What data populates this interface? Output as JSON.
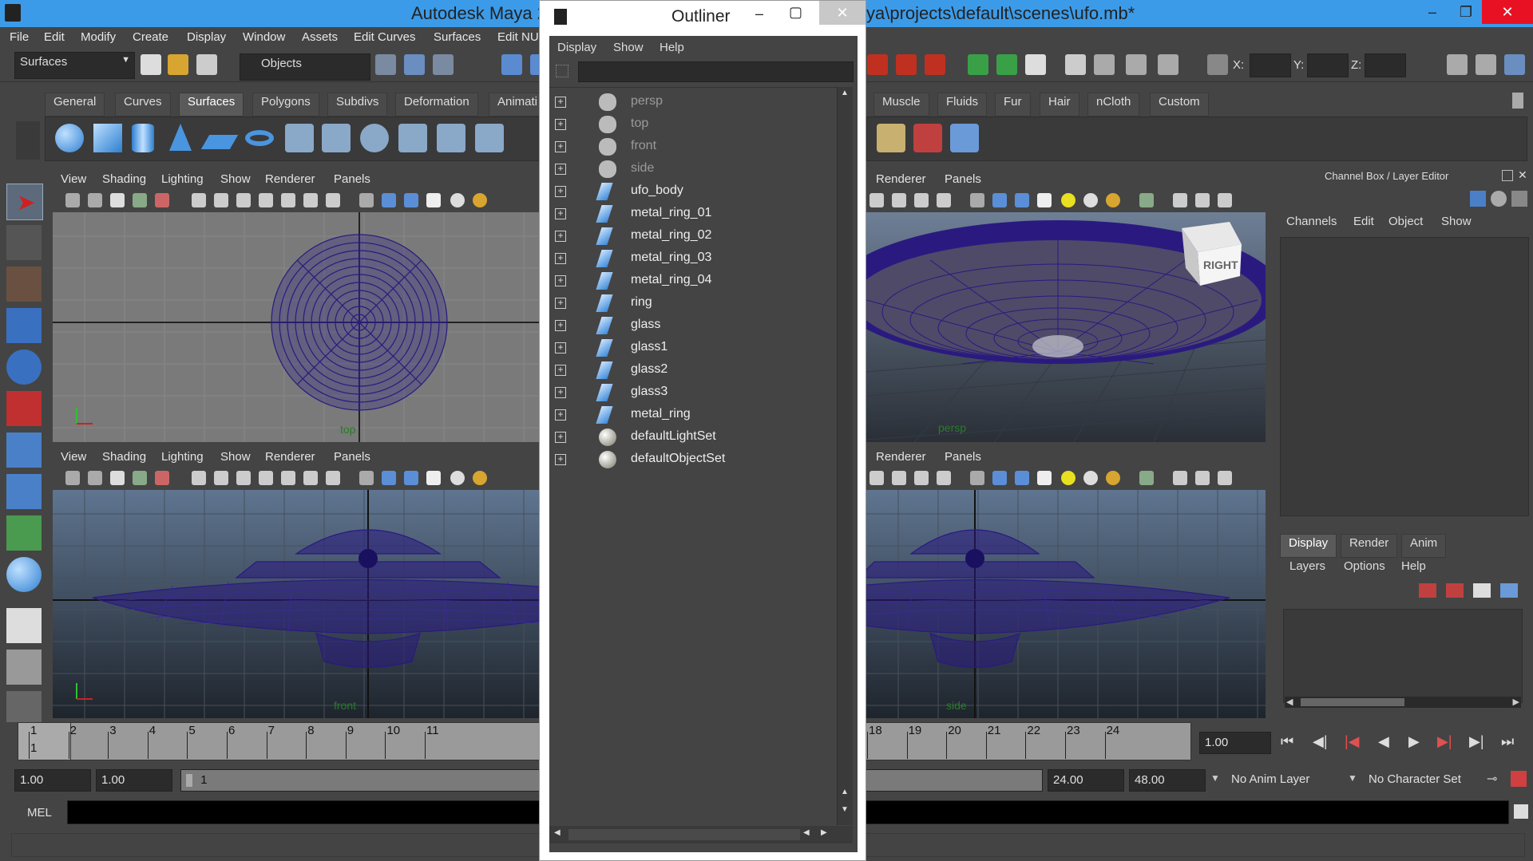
{
  "titlebar": {
    "title_left": "Autodesk Maya 2",
    "title_right": "ya\\projects\\default\\scenes\\ufo.mb*"
  },
  "menubar": {
    "items": [
      "File",
      "Edit",
      "Modify",
      "Create",
      "Display",
      "Window",
      "Assets",
      "Edit Curves",
      "Surfaces",
      "Edit NU"
    ]
  },
  "statusline": {
    "menuset": "Surfaces",
    "selection_mode": "Objects",
    "x_label": "X:",
    "y_label": "Y:",
    "z_label": "Z:"
  },
  "shelf": {
    "tabs_left": [
      "General",
      "Curves",
      "Surfaces",
      "Polygons",
      "Subdivs",
      "Deformation",
      "Animati"
    ],
    "tabs_right": [
      "Muscle",
      "Fluids",
      "Fur",
      "Hair",
      "nCloth",
      "Custom"
    ],
    "active_tab": "Surfaces"
  },
  "viewport_menu": {
    "items": [
      "View",
      "Shading",
      "Lighting",
      "Show",
      "Renderer",
      "Panels"
    ],
    "right_items": [
      "Renderer",
      "Panels"
    ]
  },
  "viewports": {
    "top_label": "top",
    "persp_label": "persp",
    "front_label": "front",
    "side_label": "side",
    "viewcube_label": "RIGHT"
  },
  "outliner": {
    "title": "Outliner",
    "menu": [
      "Display",
      "Show",
      "Help"
    ],
    "items": [
      {
        "label": "persp",
        "icon": "camera-icon",
        "dim": true
      },
      {
        "label": "top",
        "icon": "camera-icon",
        "dim": true
      },
      {
        "label": "front",
        "icon": "camera-icon",
        "dim": true
      },
      {
        "label": "side",
        "icon": "camera-icon",
        "dim": true
      },
      {
        "label": "ufo_body",
        "icon": "nurbs-surface-icon",
        "dim": false
      },
      {
        "label": "metal_ring_01",
        "icon": "nurbs-surface-icon",
        "dim": false
      },
      {
        "label": "metal_ring_02",
        "icon": "nurbs-surface-icon",
        "dim": false
      },
      {
        "label": "metal_ring_03",
        "icon": "nurbs-surface-icon",
        "dim": false
      },
      {
        "label": "metal_ring_04",
        "icon": "nurbs-surface-icon",
        "dim": false
      },
      {
        "label": "ring",
        "icon": "nurbs-surface-icon",
        "dim": false
      },
      {
        "label": "glass",
        "icon": "nurbs-surface-icon",
        "dim": false
      },
      {
        "label": "glass1",
        "icon": "nurbs-surface-icon",
        "dim": false
      },
      {
        "label": "glass2",
        "icon": "nurbs-surface-icon",
        "dim": false
      },
      {
        "label": "glass3",
        "icon": "nurbs-surface-icon",
        "dim": false
      },
      {
        "label": "metal_ring",
        "icon": "nurbs-surface-icon",
        "dim": false
      },
      {
        "label": "defaultLightSet",
        "icon": "set-icon",
        "dim": false
      },
      {
        "label": "defaultObjectSet",
        "icon": "set-icon",
        "dim": false
      }
    ]
  },
  "channelbox": {
    "title": "Channel Box / Layer Editor",
    "menu": [
      "Channels",
      "Edit",
      "Object",
      "Show"
    ],
    "layer_tabs": [
      "Display",
      "Render",
      "Anim"
    ],
    "layer_menu": [
      "Layers",
      "Options",
      "Help"
    ]
  },
  "timeslider": {
    "ticks_left": [
      "1",
      "2",
      "3",
      "4",
      "5",
      "6",
      "7",
      "8",
      "9",
      "10",
      "11"
    ],
    "ticks_right": [
      "18",
      "19",
      "20",
      "21",
      "22",
      "23",
      "24"
    ],
    "current_frame_marker": "1",
    "current_time": "1.00"
  },
  "rangeslider": {
    "start": "1.00",
    "anim_start": "1.00",
    "range_text": "1",
    "end": "24.00",
    "anim_end": "48.00",
    "anim_layer": "No Anim Layer",
    "character_set": "No Character Set"
  },
  "cmdline": {
    "label": "MEL"
  },
  "colors": {
    "titlebar": "#3c9be8",
    "close": "#e81123",
    "wire": "#2a1a80",
    "viewport_top": "#5f7590",
    "viewport_bottom": "#1e242c"
  }
}
